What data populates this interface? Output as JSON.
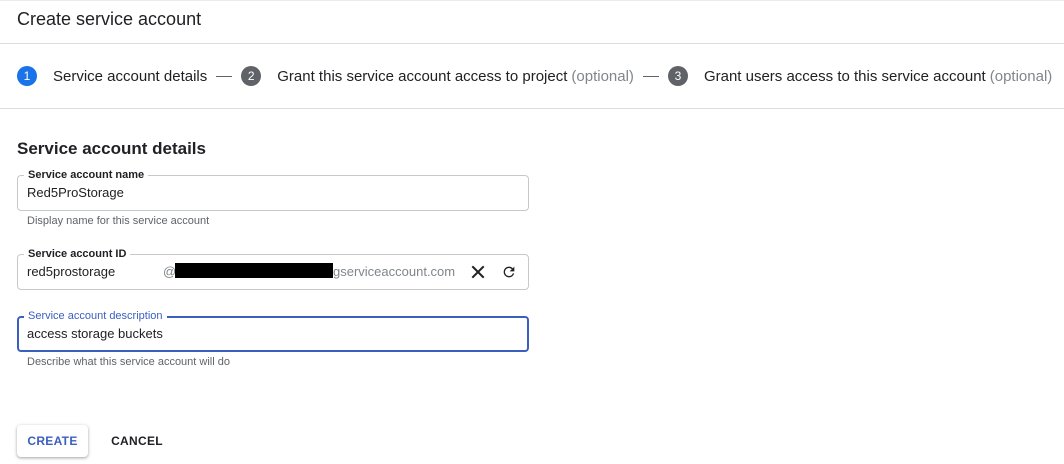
{
  "header": {
    "title": "Create service account"
  },
  "stepper": {
    "steps": [
      {
        "number": "1",
        "label": "Service account details",
        "optional": ""
      },
      {
        "number": "2",
        "label": "Grant this service account access to project",
        "optional": "(optional)"
      },
      {
        "number": "3",
        "label": "Grant users access to this service account",
        "optional": "(optional)"
      }
    ]
  },
  "form": {
    "section_title": "Service account details",
    "name": {
      "label": "Service account name",
      "value": "Red5ProStorage",
      "hint": "Display name for this service account"
    },
    "id": {
      "label": "Service account ID",
      "value": "red5prostorage",
      "at": "@",
      "domain_suffix": "gserviceaccount.com"
    },
    "description": {
      "label": "Service account description",
      "value": "access storage buckets",
      "hint": "Describe what this service account will do"
    }
  },
  "actions": {
    "create_label": "CREATE",
    "cancel_label": "CANCEL"
  },
  "icons": {
    "clear": "close-icon",
    "refresh": "refresh-icon"
  },
  "colors": {
    "accent": "#1a73e8",
    "focus": "#3b5fbf",
    "inactive_step": "#5f6368"
  }
}
